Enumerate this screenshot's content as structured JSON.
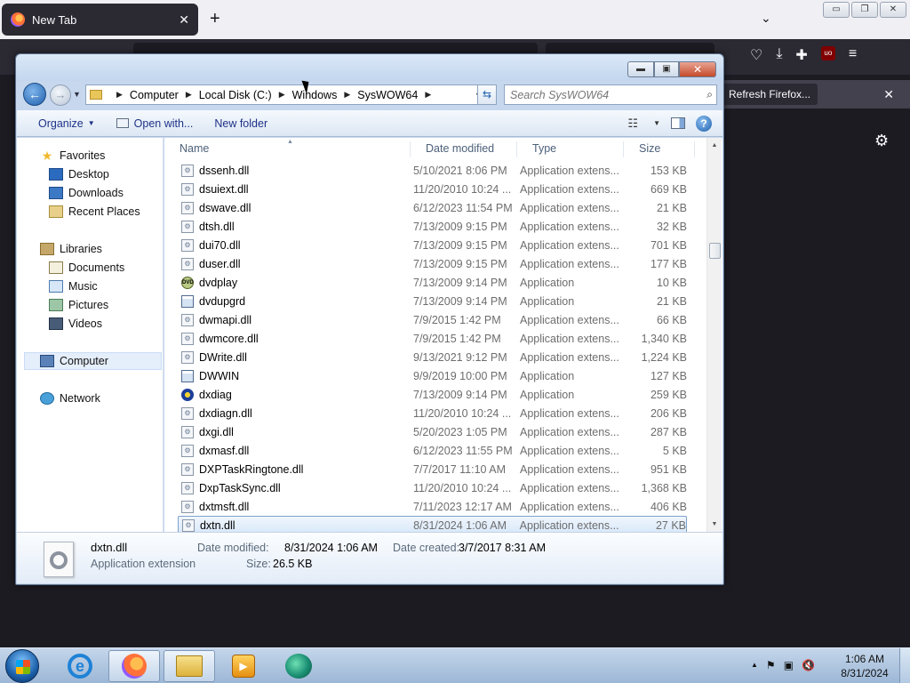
{
  "firefox": {
    "tab_title": "New Tab",
    "tab_close": "✕",
    "new_tab": "+",
    "tab_list": "⌄",
    "win_min": "▭",
    "win_restore": "❐",
    "win_close": "✕",
    "toolbar_icons": [
      "pocket-icon",
      "downloads-icon",
      "extensions-icon",
      "ublock-icon",
      "menu-icon"
    ],
    "ublock_label": "uo",
    "notification_button": "Refresh Firefox...",
    "notification_close": "✕",
    "gear": "⚙"
  },
  "explorer": {
    "caption_min": "▬",
    "caption_max": "▣",
    "caption_close": "✕",
    "breadcrumbs": [
      "Computer",
      "Local Disk (C:)",
      "Windows",
      "SysWOW64"
    ],
    "search_placeholder": "Search SysWOW64",
    "commands": {
      "organize": "Organize",
      "open_with": "Open with...",
      "new_folder": "New folder"
    },
    "nav": {
      "favorites": "Favorites",
      "desktop": "Desktop",
      "downloads": "Downloads",
      "recent_places": "Recent Places",
      "libraries": "Libraries",
      "documents": "Documents",
      "music": "Music",
      "pictures": "Pictures",
      "videos": "Videos",
      "computer": "Computer",
      "network": "Network"
    },
    "columns": {
      "name": "Name",
      "date": "Date modified",
      "type": "Type",
      "size": "Size"
    },
    "files": [
      {
        "name": "dssenh.dll",
        "date": "5/10/2021 8:06 PM",
        "type": "Application extens...",
        "size": "153 KB",
        "icon": "dll"
      },
      {
        "name": "dsuiext.dll",
        "date": "11/20/2010 10:24 ...",
        "type": "Application extens...",
        "size": "669 KB",
        "icon": "dll"
      },
      {
        "name": "dswave.dll",
        "date": "6/12/2023 11:54 PM",
        "type": "Application extens...",
        "size": "21 KB",
        "icon": "dll"
      },
      {
        "name": "dtsh.dll",
        "date": "7/13/2009 9:15 PM",
        "type": "Application extens...",
        "size": "32 KB",
        "icon": "dll"
      },
      {
        "name": "dui70.dll",
        "date": "7/13/2009 9:15 PM",
        "type": "Application extens...",
        "size": "701 KB",
        "icon": "dll"
      },
      {
        "name": "duser.dll",
        "date": "7/13/2009 9:15 PM",
        "type": "Application extens...",
        "size": "177 KB",
        "icon": "dll"
      },
      {
        "name": "dvdplay",
        "date": "7/13/2009 9:14 PM",
        "type": "Application",
        "size": "10 KB",
        "icon": "dvd"
      },
      {
        "name": "dvdupgrd",
        "date": "7/13/2009 9:14 PM",
        "type": "Application",
        "size": "21 KB",
        "icon": "app"
      },
      {
        "name": "dwmapi.dll",
        "date": "7/9/2015 1:42 PM",
        "type": "Application extens...",
        "size": "66 KB",
        "icon": "dll"
      },
      {
        "name": "dwmcore.dll",
        "date": "7/9/2015 1:42 PM",
        "type": "Application extens...",
        "size": "1,340 KB",
        "icon": "dll"
      },
      {
        "name": "DWrite.dll",
        "date": "9/13/2021 9:12 PM",
        "type": "Application extens...",
        "size": "1,224 KB",
        "icon": "dll"
      },
      {
        "name": "DWWIN",
        "date": "9/9/2019 10:00 PM",
        "type": "Application",
        "size": "127 KB",
        "icon": "app"
      },
      {
        "name": "dxdiag",
        "date": "7/13/2009 9:14 PM",
        "type": "Application",
        "size": "259 KB",
        "icon": "dx"
      },
      {
        "name": "dxdiagn.dll",
        "date": "11/20/2010 10:24 ...",
        "type": "Application extens...",
        "size": "206 KB",
        "icon": "dll"
      },
      {
        "name": "dxgi.dll",
        "date": "5/20/2023 1:05 PM",
        "type": "Application extens...",
        "size": "287 KB",
        "icon": "dll"
      },
      {
        "name": "dxmasf.dll",
        "date": "6/12/2023 11:55 PM",
        "type": "Application extens...",
        "size": "5 KB",
        "icon": "dll"
      },
      {
        "name": "DXPTaskRingtone.dll",
        "date": "7/7/2017 11:10 AM",
        "type": "Application extens...",
        "size": "951 KB",
        "icon": "dll"
      },
      {
        "name": "DxpTaskSync.dll",
        "date": "11/20/2010 10:24 ...",
        "type": "Application extens...",
        "size": "1,368 KB",
        "icon": "dll"
      },
      {
        "name": "dxtmsft.dll",
        "date": "7/11/2023 12:17 AM",
        "type": "Application extens...",
        "size": "406 KB",
        "icon": "dll"
      },
      {
        "name": "dxtn.dll",
        "date": "8/31/2024 1:06 AM",
        "type": "Application extens...",
        "size": "27 KB",
        "icon": "dll",
        "selected": true
      }
    ],
    "details": {
      "name": "dxtn.dll",
      "type": "Application extension",
      "modified_label": "Date modified:",
      "modified_value": "8/31/2024 1:06 AM",
      "created_label": "Date created:",
      "created_value": "3/7/2017 8:31 AM",
      "size_label": "Size:",
      "size_value": "26.5 KB"
    }
  },
  "taskbar": {
    "time": "1:06 AM",
    "date": "8/31/2024",
    "tray_arrow": "▲",
    "ie_label": "e",
    "media_label": "▶"
  }
}
